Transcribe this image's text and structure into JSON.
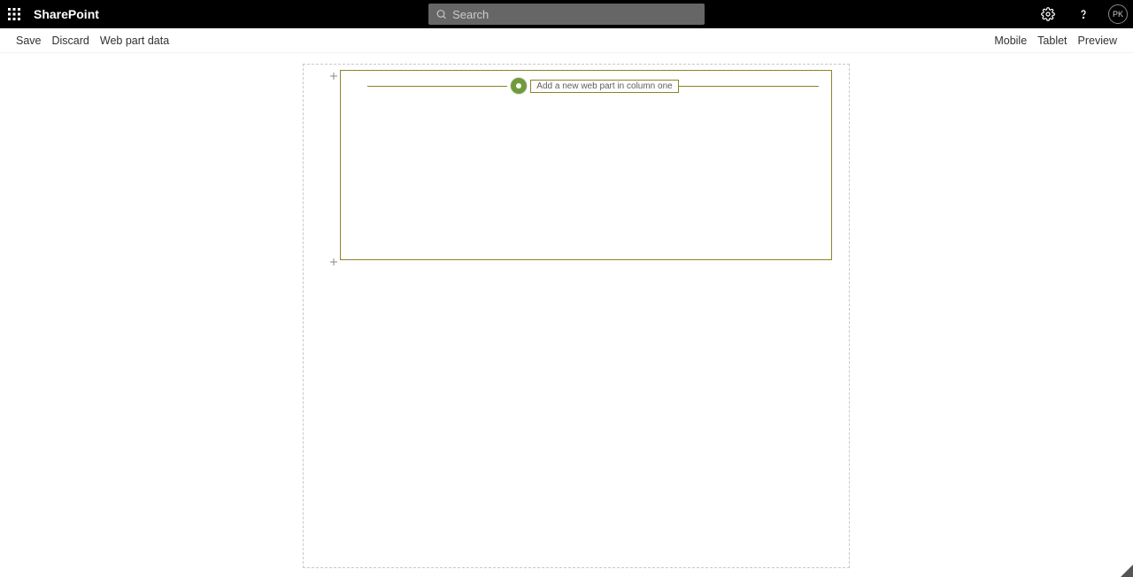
{
  "suite": {
    "brand": "SharePoint",
    "search_placeholder": "Search",
    "avatar_initials": "PK"
  },
  "command_bar": {
    "left": {
      "save": "Save",
      "discard": "Discard",
      "web_part_data": "Web part data"
    },
    "right": {
      "mobile": "Mobile",
      "tablet": "Tablet",
      "preview": "Preview"
    }
  },
  "canvas": {
    "add_web_part_label": "Add a new web part in column one"
  }
}
